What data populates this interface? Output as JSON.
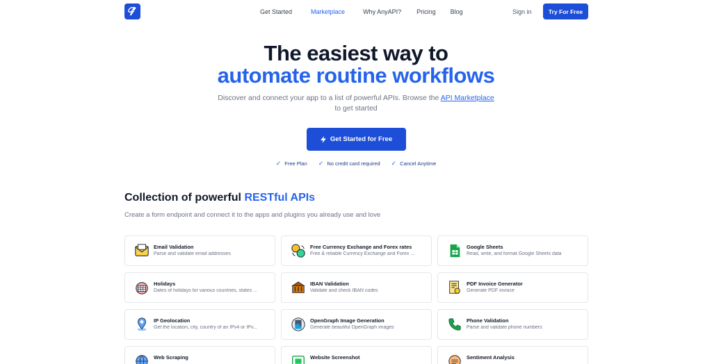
{
  "nav": {
    "links": [
      {
        "label": "Get Started",
        "active": false
      },
      {
        "label": "Marketplace",
        "active": true
      },
      {
        "label": "Why AnyAPI?",
        "active": false
      },
      {
        "label": "Pricing",
        "active": false
      },
      {
        "label": "Blog",
        "active": false
      }
    ],
    "signin": "Sign in",
    "try": "Try For Free"
  },
  "hero": {
    "line1": "The easiest way to",
    "line2": "automate routine workflows",
    "sub_a": "Discover and connect your app to a list of powerful APIs. Browse the ",
    "sub_link": "API Marketplace",
    "sub_b": "to get started",
    "cta": "Get Started for Free",
    "perks": [
      "Free Plan",
      "No credit card required",
      "Cancel Anytime"
    ]
  },
  "collection": {
    "title_a": "Collection of powerful ",
    "title_b": "RESTful APIs",
    "sub": "Create a form endpoint and connect it to the apps and plugins you already use and love"
  },
  "apis": [
    {
      "title": "Email Validation",
      "desc": "Parse and validate email addresses",
      "icon": "envelope-icon"
    },
    {
      "title": "Free Currency Exchange and Forex rates",
      "desc": "Free & reliable Currency Exchange and Forex ...",
      "icon": "currency-exchange-icon"
    },
    {
      "title": "Google Sheets",
      "desc": "Read, write, and format Google Sheets data",
      "icon": "spreadsheet-icon"
    },
    {
      "title": "Holidays",
      "desc": "Dates of holidays for various countries, states ...",
      "icon": "calendar-icon"
    },
    {
      "title": "IBAN Validation",
      "desc": "Validate and check IBAN codes",
      "icon": "bank-icon"
    },
    {
      "title": "PDF Invoice Generator",
      "desc": "Generate PDF invoice",
      "icon": "invoice-icon"
    },
    {
      "title": "IP Geolocation",
      "desc": "Get the location, city, country of an IPv4 or IPv...",
      "icon": "map-pin-icon"
    },
    {
      "title": "OpenGraph Image Generation",
      "desc": "Generate beautiful OpenGraph images",
      "icon": "image-icon"
    },
    {
      "title": "Phone Validation",
      "desc": "Parse and validate phone numbers",
      "icon": "phone-icon"
    },
    {
      "title": "Web Scraping",
      "desc": "",
      "icon": "globe-icon"
    },
    {
      "title": "Website Screenshot",
      "desc": "",
      "icon": "screenshot-icon"
    },
    {
      "title": "Sentiment Analysis",
      "desc": "",
      "icon": "sentiment-icon"
    }
  ]
}
